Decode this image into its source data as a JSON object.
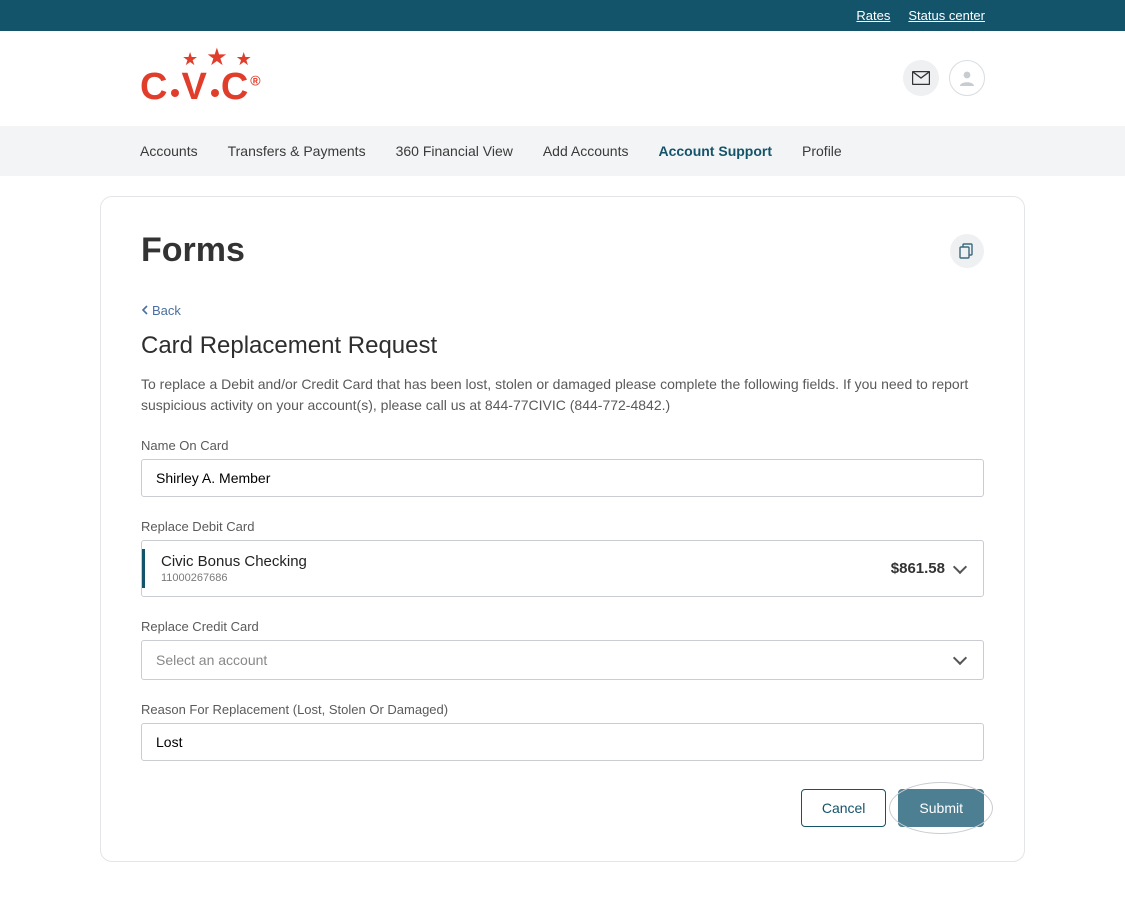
{
  "topbar": {
    "rates": "Rates",
    "status": "Status center"
  },
  "brand": {
    "name": "CIVIC"
  },
  "nav": {
    "items": [
      {
        "label": "Accounts",
        "active": false
      },
      {
        "label": "Transfers & Payments",
        "active": false
      },
      {
        "label": "360 Financial View",
        "active": false
      },
      {
        "label": "Add Accounts",
        "active": false
      },
      {
        "label": "Account Support",
        "active": true
      },
      {
        "label": "Profile",
        "active": false
      }
    ]
  },
  "page": {
    "title": "Forms",
    "back": "Back",
    "form_title": "Card Replacement Request",
    "description": "To replace a Debit and/or Credit Card that has been lost, stolen or damaged please complete the following fields. If you need to report suspicious activity on your account(s), please call us at 844-77CIVIC (844-772-4842.)"
  },
  "fields": {
    "name_label": "Name On Card",
    "name_value": "Shirley A. Member",
    "debit_label": "Replace Debit Card",
    "debit_account_name": "Civic Bonus Checking",
    "debit_account_number": "11000267686",
    "debit_account_balance": "$861.58",
    "credit_label": "Replace Credit Card",
    "credit_placeholder": "Select an account",
    "reason_label": "Reason For Replacement (Lost, Stolen Or Damaged)",
    "reason_value": "Lost"
  },
  "actions": {
    "cancel": "Cancel",
    "submit": "Submit"
  }
}
